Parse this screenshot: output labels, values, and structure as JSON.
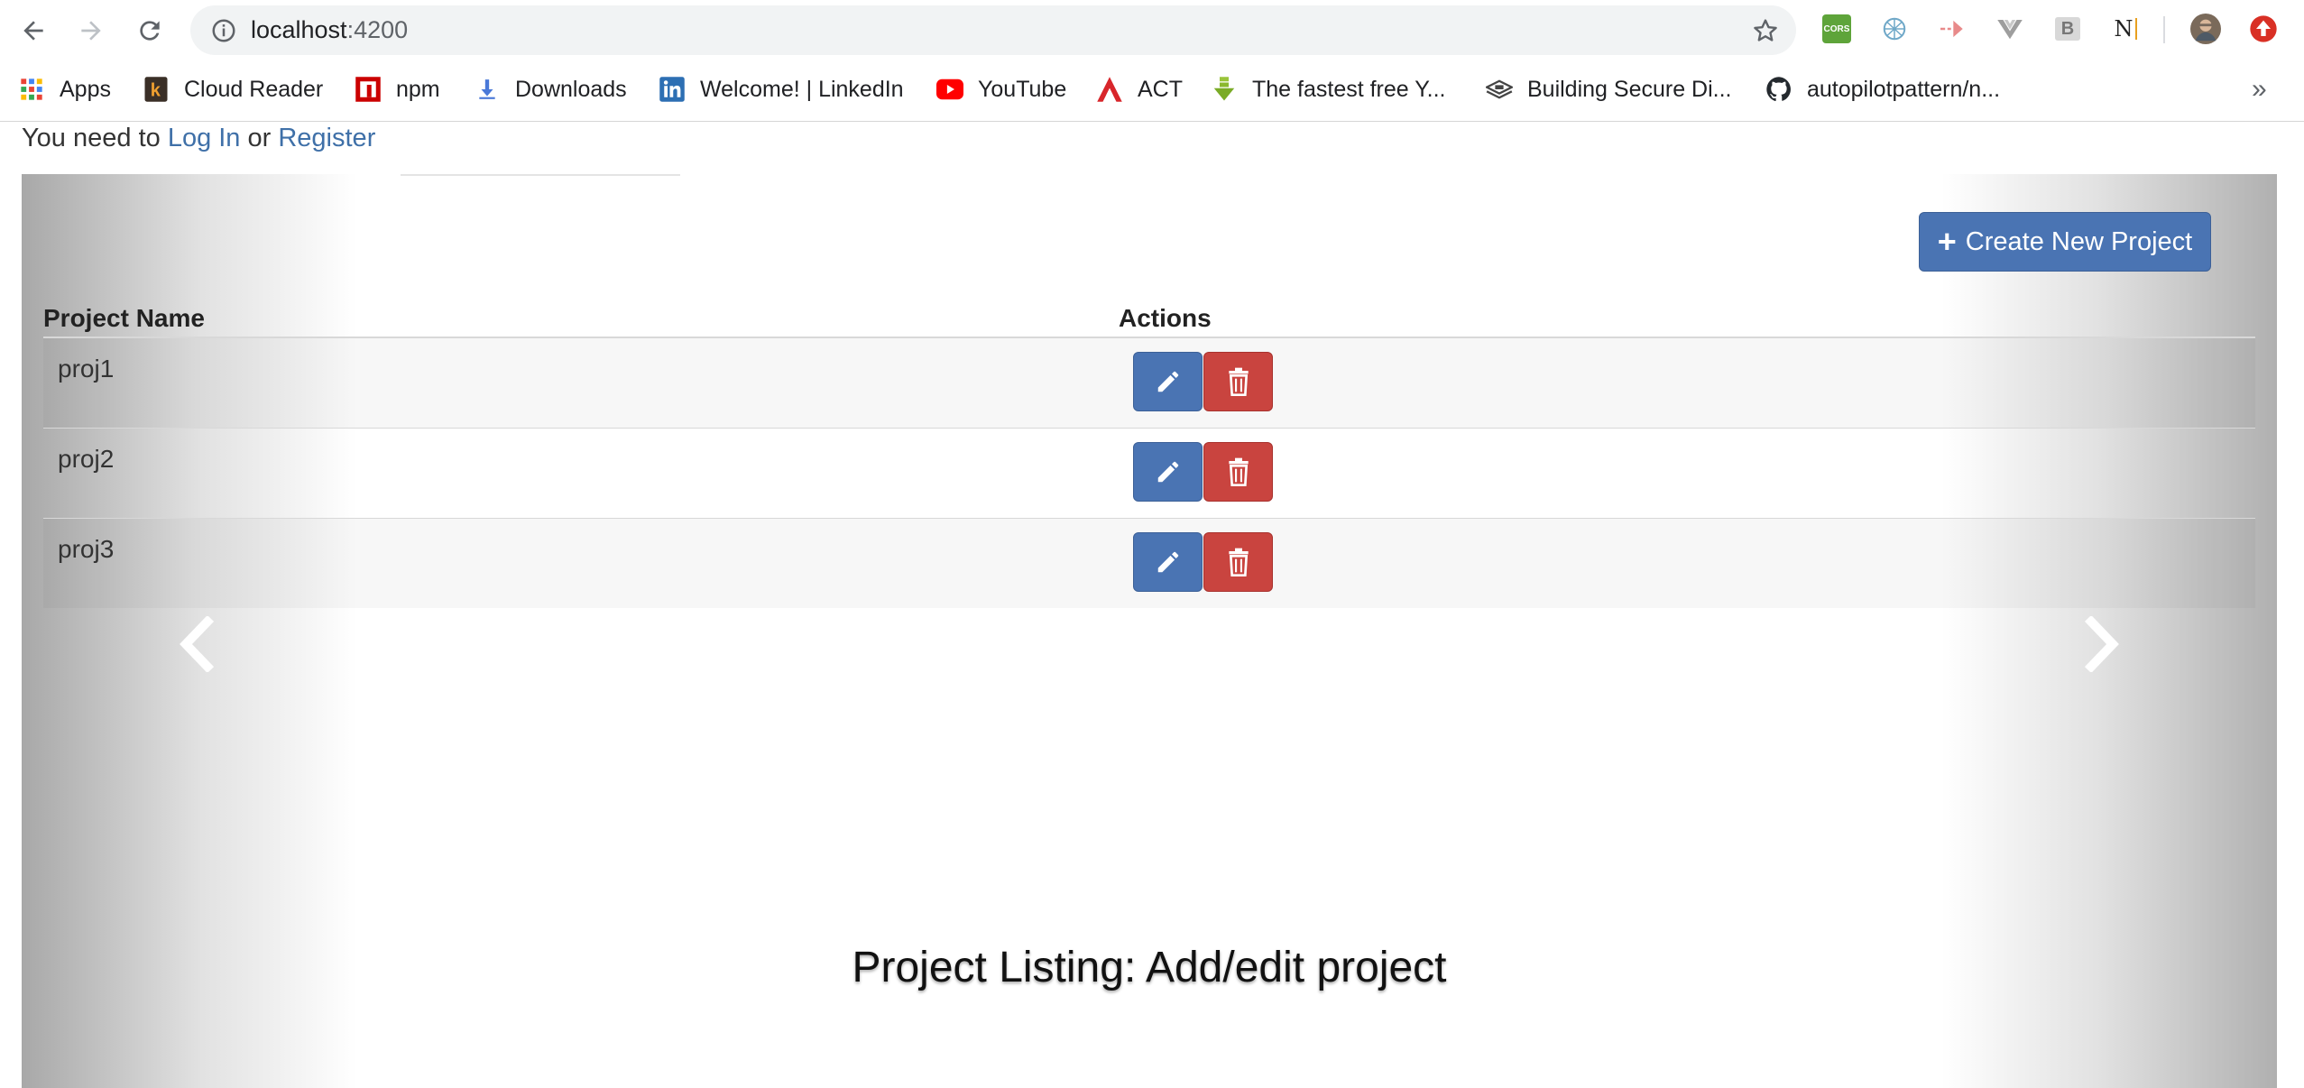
{
  "browser": {
    "url_host": "localhost",
    "url_port": ":4200",
    "bookmarks": [
      {
        "label": "Apps",
        "icon": "apps-grid-icon"
      },
      {
        "label": "Cloud Reader",
        "icon": "kindle-icon"
      },
      {
        "label": "npm",
        "icon": "npm-icon"
      },
      {
        "label": "Downloads",
        "icon": "download-icon"
      },
      {
        "label": "Welcome! | LinkedIn",
        "icon": "linkedin-icon"
      },
      {
        "label": "YouTube",
        "icon": "youtube-icon"
      },
      {
        "label": "ACT",
        "icon": "act-icon"
      },
      {
        "label": "The fastest free Y...",
        "icon": "download-arrow-icon"
      },
      {
        "label": "Building Secure Di...",
        "icon": "stack-icon"
      },
      {
        "label": "autopilotpattern/n...",
        "icon": "github-icon"
      }
    ],
    "extensions": [
      {
        "name": "cors-extension-icon",
        "text": "CORS"
      },
      {
        "name": "network-extension-icon",
        "text": ""
      },
      {
        "name": "arrow-extension-icon",
        "text": ""
      },
      {
        "name": "vue-devtools-icon",
        "text": ""
      },
      {
        "name": "b-extension-icon",
        "text": "B"
      },
      {
        "name": "n-extension-icon",
        "text": "N"
      }
    ],
    "overflow_label": "»"
  },
  "page": {
    "login_prefix": "You need to ",
    "login_link": "Log In",
    "login_or": " or ",
    "register_link": "Register",
    "create_button": "Create New Project",
    "table": {
      "col_name": "Project Name",
      "col_actions": "Actions",
      "rows": [
        {
          "name": "proj1"
        },
        {
          "name": "proj2"
        },
        {
          "name": "proj3"
        }
      ]
    },
    "caption": "Project Listing: Add/edit project"
  },
  "colors": {
    "primary": "#4a74b3",
    "danger": "#c9443f",
    "link": "#3f70a8"
  }
}
